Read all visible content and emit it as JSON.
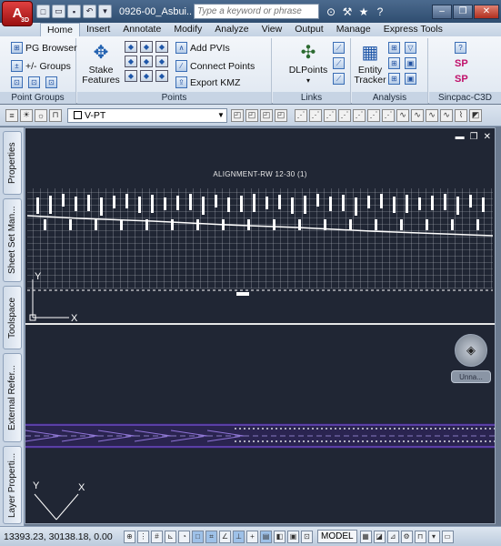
{
  "titlebar": {
    "app_logo": "A",
    "app_logo_sub": "3D",
    "doc_title": "0926-00_Asbui...",
    "search_placeholder": "Type a keyword or phrase",
    "quick_access_icons": [
      "new-icon",
      "open-icon",
      "save-icon",
      "undo-icon",
      "dropdown-icon"
    ],
    "title_icons": [
      "binoculars-icon",
      "wrench-icon",
      "star-icon",
      "help-icon"
    ],
    "window_controls": [
      "minimize",
      "restore",
      "close"
    ]
  },
  "tabs": [
    "Home",
    "Insert",
    "Annotate",
    "Modify",
    "Analyze",
    "View",
    "Output",
    "Manage",
    "Express Tools"
  ],
  "ribbon": {
    "point_groups": {
      "items": [
        "PG Browser",
        "+/- Groups"
      ],
      "label": "Point Groups"
    },
    "points": {
      "stake_label_line1": "Stake",
      "stake_label_line2": "Features",
      "items": [
        "Add PVIs",
        "Connect Points",
        "Export KMZ"
      ],
      "label": "Points"
    },
    "links": {
      "dlpoints": "DLPoints",
      "label": "Links"
    },
    "analysis": {
      "entity_line1": "Entity",
      "entity_line2": "Tracker",
      "label": "Analysis"
    },
    "sincpac": {
      "label": "Sincpac-C3D",
      "sp1": "SP",
      "sp2": "SP"
    }
  },
  "layerbar": {
    "layer_name": "V-PT"
  },
  "palettes": [
    "Properties",
    "Sheet Set Man...",
    "Toolspace",
    "External Refer...",
    "Layer Properti..."
  ],
  "viewport_top": {
    "profile_title": "ALIGNMENT-RW 12-30 (1)",
    "axis_y": "Y",
    "axis_x": "X"
  },
  "viewport_bottom": {
    "ucs_label": "Unna...",
    "axis_y": "Y",
    "axis_x": "X"
  },
  "statusbar": {
    "coordinates": "13393.23, 30138.18, 0.00",
    "model_label": "MODEL"
  },
  "colors": {
    "drawing_bg": "#202634",
    "title_bar": "#2f4d70",
    "accent": "#3a6db5",
    "purple_linework": "#5c3fa8"
  }
}
